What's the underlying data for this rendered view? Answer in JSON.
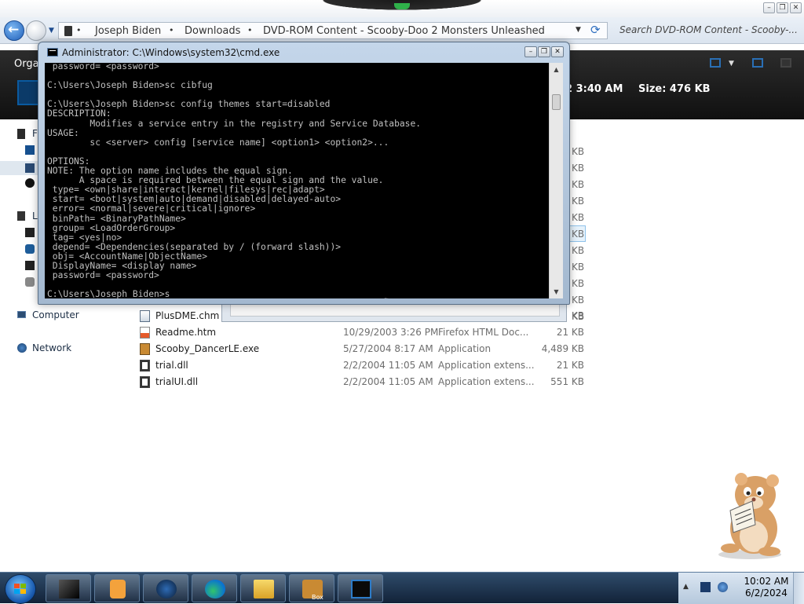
{
  "explorer": {
    "breadcrumbs": [
      "Joseph Biden",
      "Downloads",
      "DVD-ROM Content - Scooby-Doo 2 Monsters Unleashed"
    ],
    "search_placeholder": "Search DVD-ROM Content - Scooby-...",
    "organize_label": "Orga",
    "details_date_fragment": "2 3:40 AM",
    "details_size": "Size: 476 KB",
    "nav_pane": {
      "computer_label": "Computer",
      "network_label": "Network",
      "truncated_favorites_label": "F",
      "truncated_libraries_label": "L"
    },
    "size_column_partial": [
      "KB",
      "KB",
      "KB",
      "KB",
      "KB",
      "KB",
      "KB",
      "KB",
      "KB",
      "KB",
      "KB"
    ],
    "files": [
      {
        "name": "PlusDME.chm",
        "date": "",
        "type": "",
        "size": "KB",
        "icon": "help-file-icon"
      },
      {
        "name": "Readme.htm",
        "date": "10/29/2003 3:26 PM",
        "type": "Firefox HTML Doc...",
        "size": "21 KB",
        "icon": "html-file-icon"
      },
      {
        "name": "Scooby_DancerLE.exe",
        "date": "5/27/2004 8:17 AM",
        "type": "Application",
        "size": "4,489 KB",
        "icon": "exe-file-icon"
      },
      {
        "name": "trial.dll",
        "date": "2/2/2004 11:05 AM",
        "type": "Application extens...",
        "size": "21 KB",
        "icon": "dll-file-icon"
      },
      {
        "name": "trialUI.dll",
        "date": "2/2/2004 11:05 AM",
        "type": "Application extens...",
        "size": "551 KB",
        "icon": "dll-file-icon"
      }
    ]
  },
  "cmd": {
    "title": "Administrator: C:\\Windows\\system32\\cmd.exe",
    "lines": [
      " password= <password>",
      "",
      "C:\\Users\\Joseph Biden>sc cibfug",
      "",
      "C:\\Users\\Joseph Biden>sc config themes start=disabled",
      "DESCRIPTION:",
      "        Modifies a service entry in the registry and Service Database.",
      "USAGE:",
      "        sc <server> config [service name] <option1> <option2>...",
      "",
      "OPTIONS:",
      "NOTE: The option name includes the equal sign.",
      "      A space is required between the equal sign and the value.",
      " type= <own|share|interact|kernel|filesys|rec|adapt>",
      " start= <boot|system|auto|demand|disabled|delayed-auto>",
      " error= <normal|severe|critical|ignore>",
      " binPath= <BinaryPathName>",
      " group= <LoadOrderGroup>",
      " tag= <yes|no>",
      " depend= <Dependencies(separated by / (forward slash))>",
      " obj= <AccountName|ObjectName>",
      " DisplayName= <display name>",
      " password= <password>",
      "",
      "C:\\Users\\Joseph Biden>s_"
    ]
  },
  "taskbar": {
    "time": "10:02 AM",
    "date": "6/2/2024",
    "buttons": [
      "black-cube-app-icon",
      "media-player-icon",
      "dark-globe-icon",
      "edge-browser-icon",
      "file-explorer-icon",
      "scooby-box-icon",
      "cmd-icon"
    ],
    "box_label": "Box"
  },
  "colors": {
    "console_bg": "#000000",
    "console_fg": "#c0c0c0",
    "taskbar": "#1c3350",
    "explorer_toolbar": "#1a1a1a"
  }
}
